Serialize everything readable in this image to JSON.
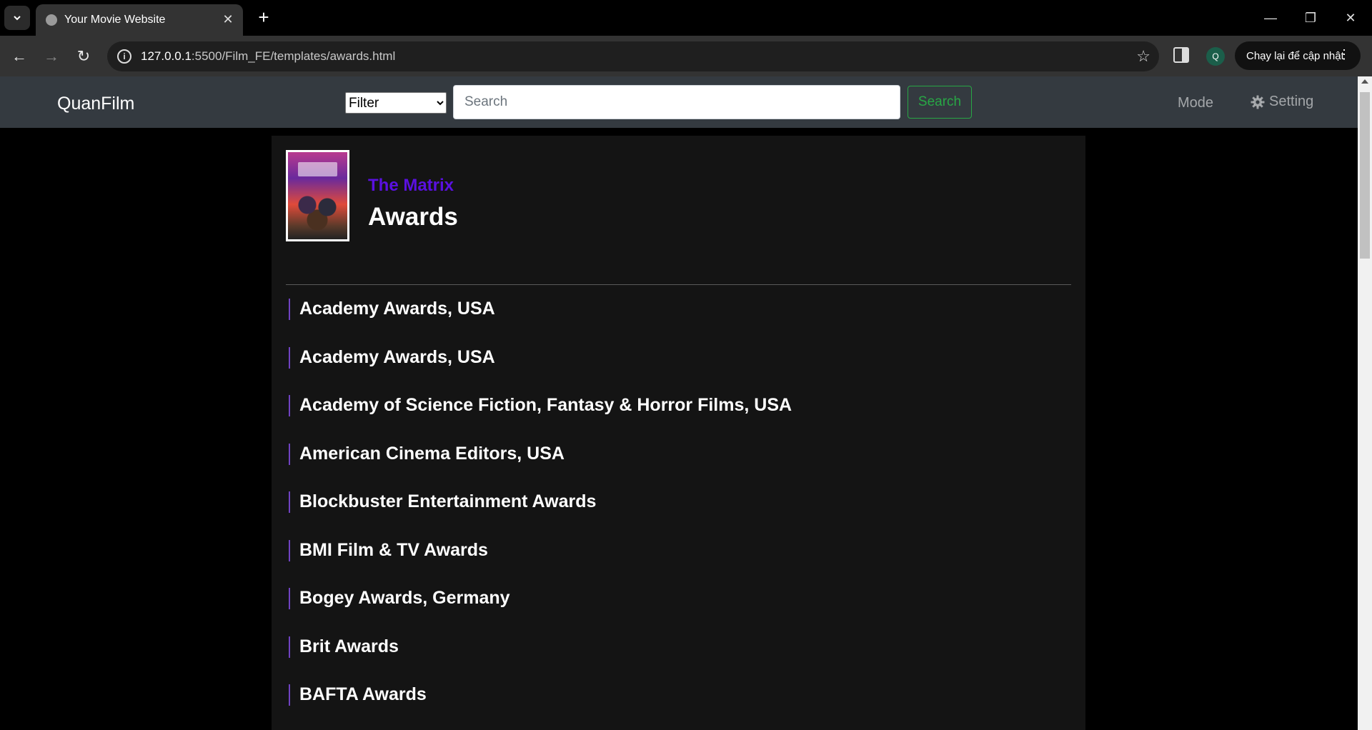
{
  "browser": {
    "tab_title": "Your Movie Website",
    "url_host": "127.0.0.1",
    "url_rest": ":5500/Film_FE/templates/awards.html",
    "profile_initial": "Q",
    "update_label": "Chạy lại để cập nhật"
  },
  "navbar": {
    "brand": "QuanFilm",
    "filter_selected": "Filter",
    "search_placeholder": "Search",
    "search_button": "Search",
    "mode_label": "Mode",
    "setting_label": "Setting"
  },
  "film": {
    "title": "The Matrix",
    "heading": "Awards"
  },
  "awards": [
    "Academy Awards, USA",
    "Academy Awards, USA",
    "Academy of Science Fiction, Fantasy & Horror Films, USA",
    "American Cinema Editors, USA",
    "Blockbuster Entertainment Awards",
    "BMI Film & TV Awards",
    "Bogey Awards, Germany",
    "Brit Awards",
    "BAFTA Awards"
  ],
  "colors": {
    "navbar_bg": "#343a40",
    "film_title": "#5a10e0",
    "award_bar": "#6f42c1",
    "search_button": "#28a745"
  }
}
